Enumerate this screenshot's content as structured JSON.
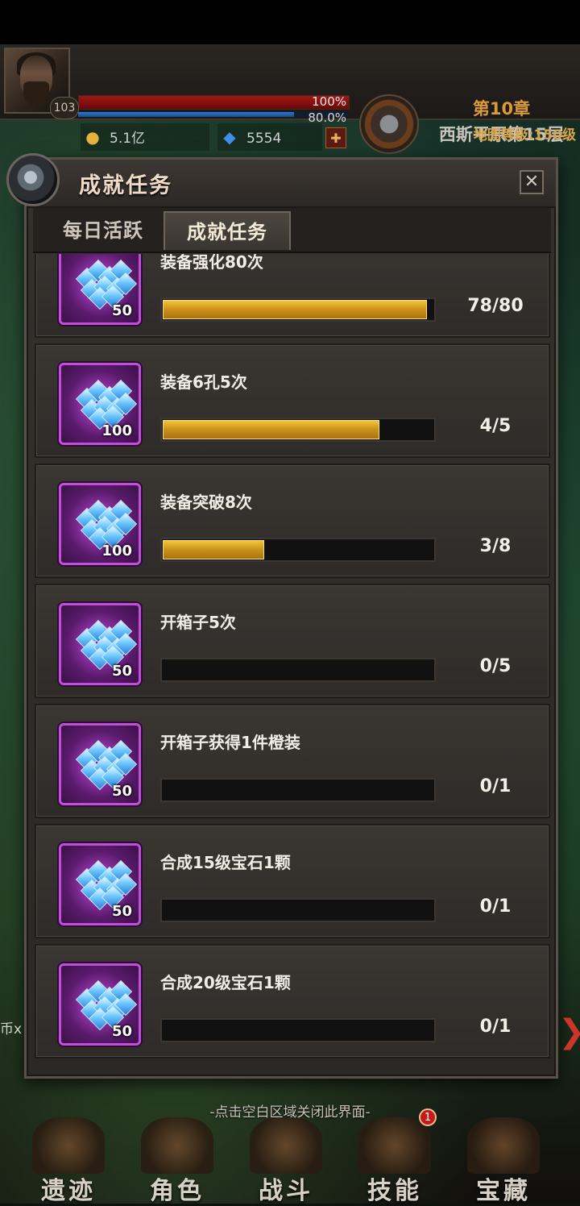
{
  "hud": {
    "level": "103",
    "hp_percent_label": "100%",
    "mp_percent_label": "80.0%",
    "hp_fraction": 1.0,
    "mp_fraction": 0.8,
    "gold": "5.1亿",
    "gems": "5554",
    "chapter": "第10章",
    "stage": "西斯平原第15层",
    "side_info": [
      "地图等级:150级"
    ]
  },
  "modal": {
    "title": "成就任务",
    "close_label": "✕",
    "tabs": [
      {
        "label": "每日活跃",
        "active": false
      },
      {
        "label": "成就任务",
        "active": true
      }
    ],
    "items": [
      {
        "name": "装备强化80次",
        "reward_qty": "50",
        "progress": "78/80",
        "current": 78,
        "total": 80
      },
      {
        "name": "装备6孔5次",
        "reward_qty": "100",
        "progress": "4/5",
        "current": 4,
        "total": 5
      },
      {
        "name": "装备突破8次",
        "reward_qty": "100",
        "progress": "3/8",
        "current": 3,
        "total": 8
      },
      {
        "name": "开箱子5次",
        "reward_qty": "50",
        "progress": "0/5",
        "current": 0,
        "total": 5
      },
      {
        "name": "开箱子获得1件橙装",
        "reward_qty": "50",
        "progress": "0/1",
        "current": 0,
        "total": 1
      },
      {
        "name": "合成15级宝石1颗",
        "reward_qty": "50",
        "progress": "0/1",
        "current": 0,
        "total": 1
      },
      {
        "name": "合成20级宝石1颗",
        "reward_qty": "50",
        "progress": "0/1",
        "current": 0,
        "total": 1
      }
    ]
  },
  "hint": "-点击空白区域关闭此界面-",
  "bottom_nav": [
    {
      "label": "遗迹"
    },
    {
      "label": "角色"
    },
    {
      "label": "战斗"
    },
    {
      "label": "技能",
      "badge": "1"
    },
    {
      "label": "宝藏"
    }
  ],
  "left_side_text": "币x",
  "colors": {
    "progress_fill": "#d9a22a",
    "reward_frame": "#c14fd9",
    "chapter_text": "#d99a3b"
  },
  "icons": {
    "reward": "crystal-gems-icon",
    "gold": "gold-coin-icon",
    "gem": "blue-gem-icon",
    "close": "close-icon"
  }
}
